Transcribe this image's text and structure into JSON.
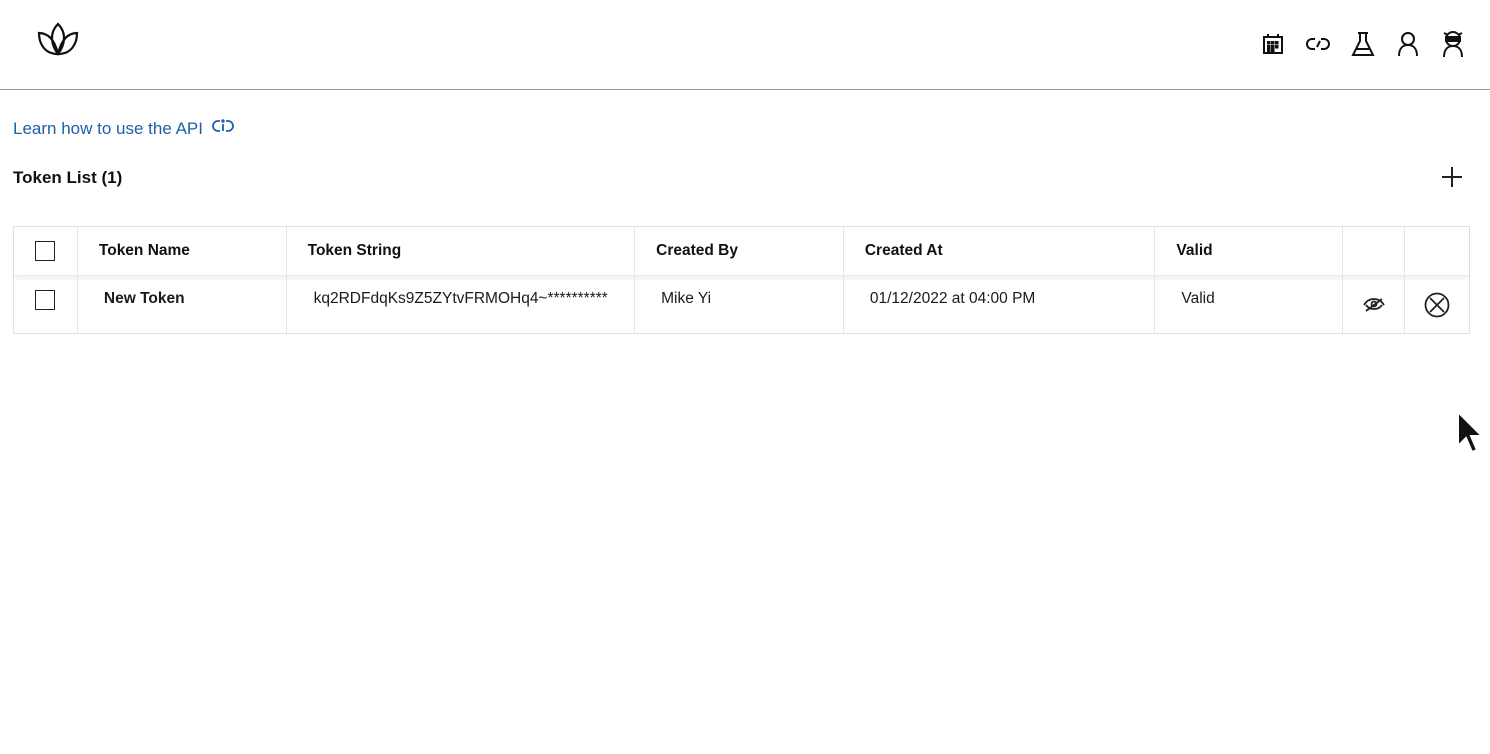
{
  "header": {
    "logo_icon": "leaf-logo-icon",
    "nav_icons": [
      "calendar-icon",
      "link-icon",
      "flask-icon",
      "user-icon",
      "ninja-avatar-icon"
    ]
  },
  "learn_link": {
    "label": "Learn how to use the API",
    "icon": "api-help-icon",
    "color": "#1f5fa8"
  },
  "token_list": {
    "title": "Token List (1)",
    "add_icon": "plus-icon",
    "columns": [
      "Token Name",
      "Token String",
      "Created By",
      "Created At",
      "Valid"
    ],
    "rows": [
      {
        "name": "New Token",
        "token_string": "kq2RDFdqKs9Z5ZYtvFRMOHq4~**********",
        "created_by": "Mike Yi",
        "created_at": "01/12/2022 at 04:00 PM",
        "valid": "Valid",
        "actions": [
          "hide-eye-icon",
          "revoke-x-icon"
        ]
      }
    ]
  }
}
